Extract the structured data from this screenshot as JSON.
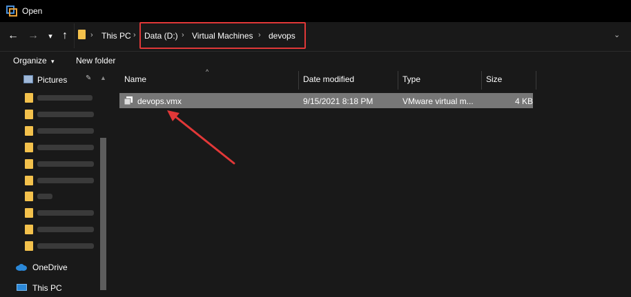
{
  "window": {
    "title": "Open"
  },
  "nav": {
    "back": "←",
    "forward": "→",
    "recent": "▾",
    "up": "↑"
  },
  "breadcrumb": [
    {
      "label": "This PC"
    },
    {
      "label": "Data (D:)"
    },
    {
      "label": "Virtual Machines"
    },
    {
      "label": "devops"
    }
  ],
  "toolbar": {
    "organize": "Organize",
    "organize_arrow": "▾",
    "new_folder": "New folder"
  },
  "sidebar": {
    "pinned": {
      "label": "Pictures",
      "pin": "📌"
    },
    "onedrive": "OneDrive",
    "thispc": "This PC"
  },
  "columns": {
    "name": "Name",
    "date": "Date modified",
    "type": "Type",
    "size": "Size"
  },
  "files": [
    {
      "name": "devops.vmx",
      "date": "9/15/2021 8:18 PM",
      "type": "VMware virtual m...",
      "size": "4 KB"
    }
  ],
  "colors": {
    "highlight": "#e23838",
    "selected_row": "#777777",
    "folder": "#f3c14c"
  }
}
